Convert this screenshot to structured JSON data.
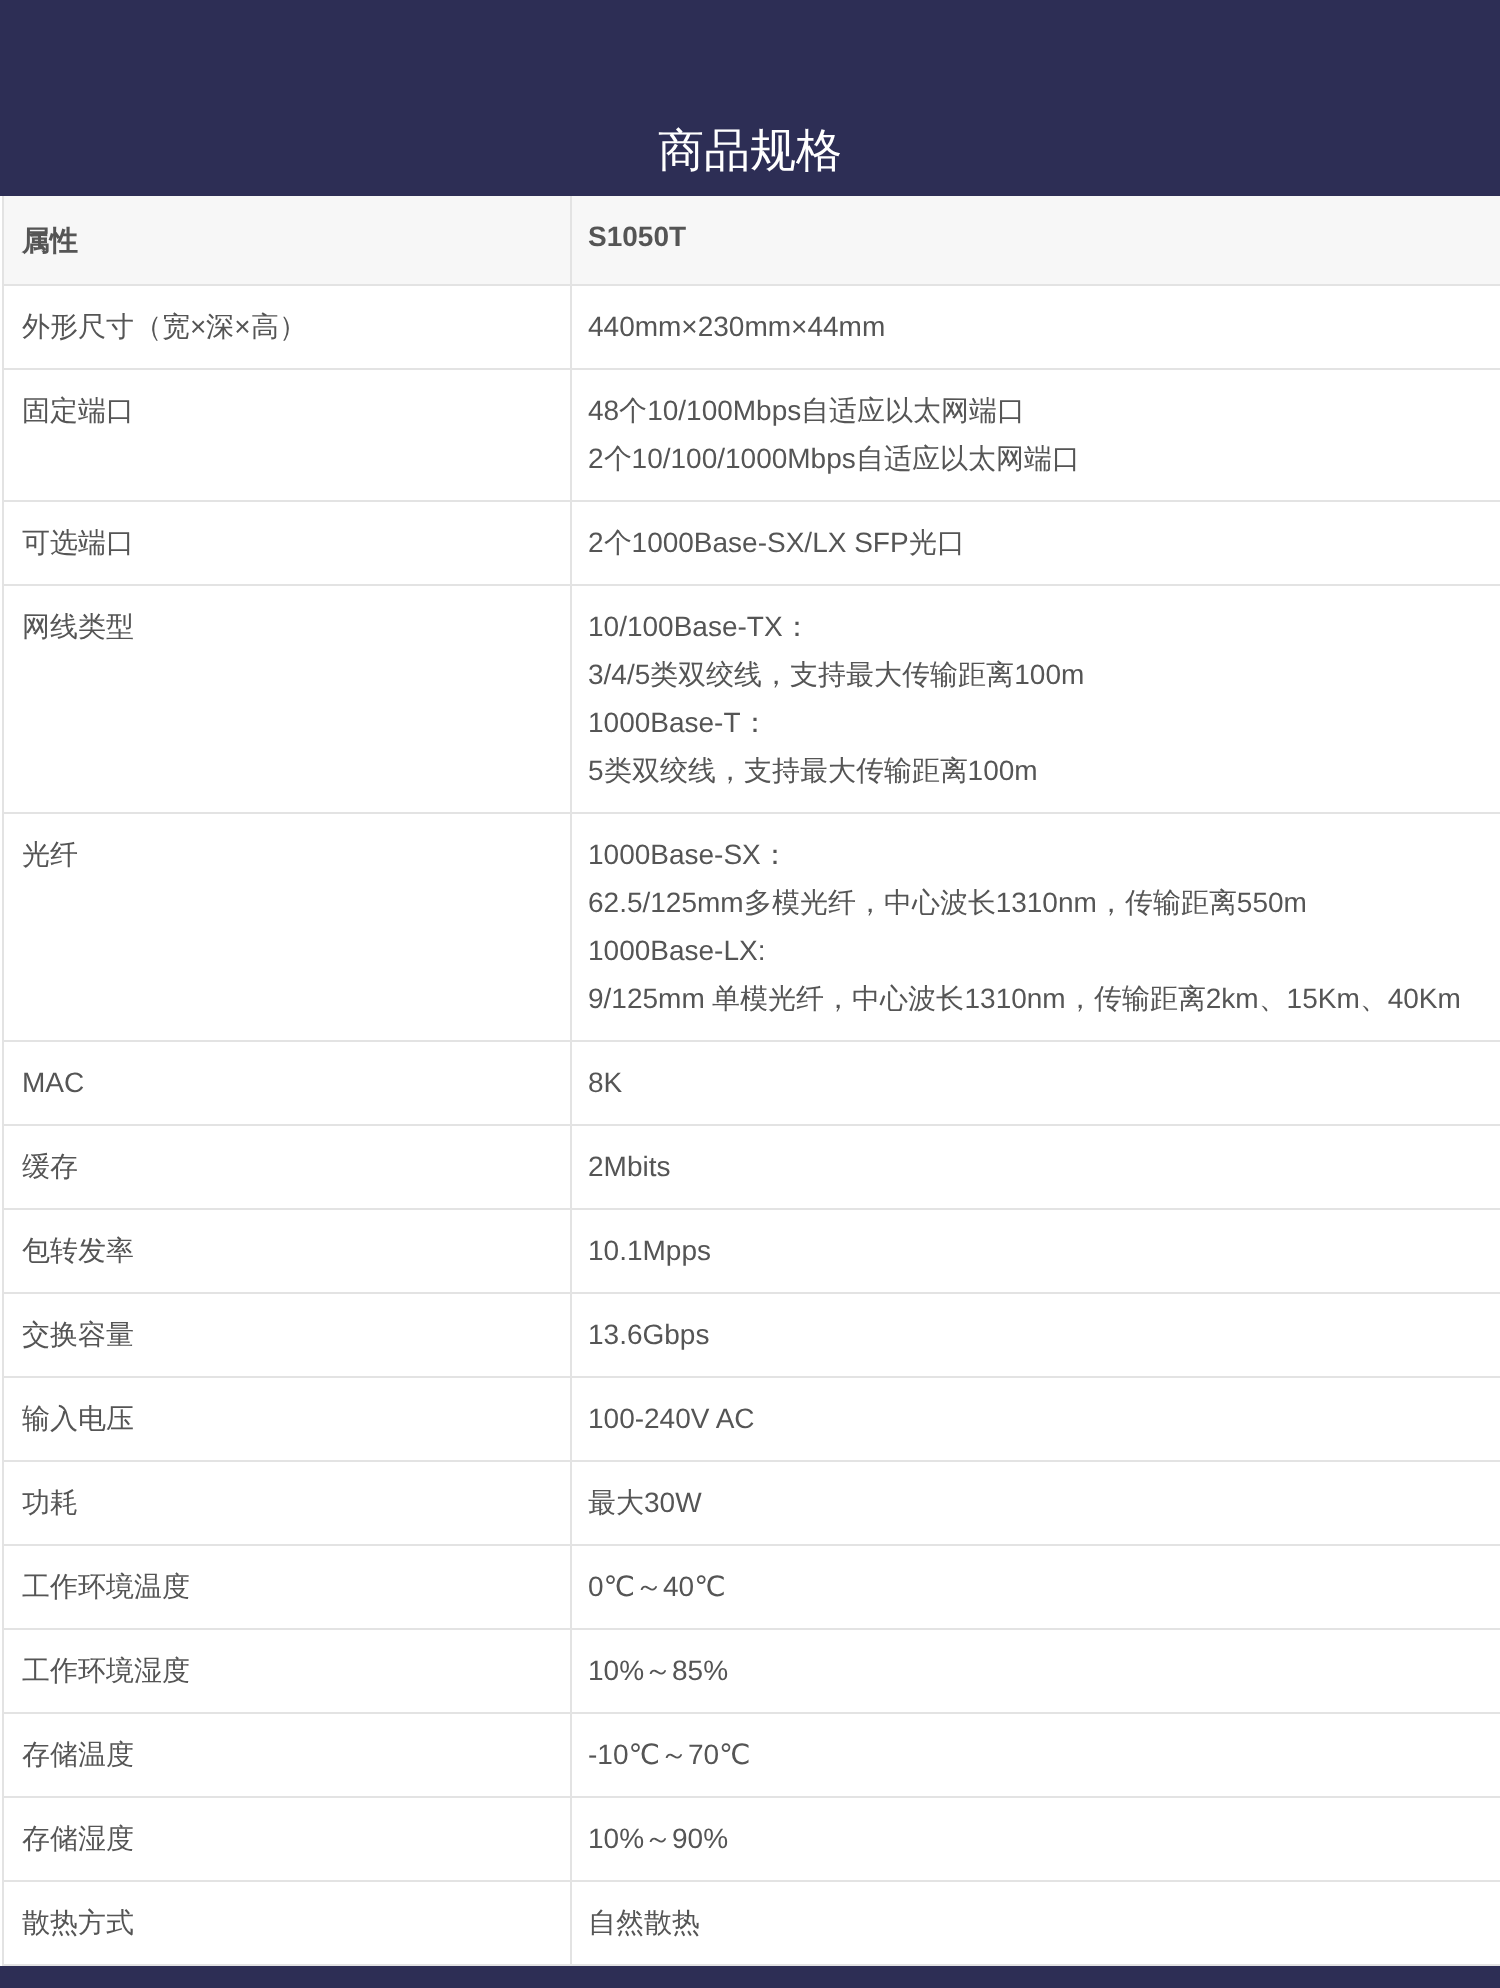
{
  "title": "商品规格",
  "table": {
    "columns": [
      "属性",
      "S1050T"
    ],
    "rows": [
      {
        "label": "外形尺寸（宽×深×高）",
        "value": [
          "440mm×230mm×44mm"
        ]
      },
      {
        "label": "固定端口",
        "value": [
          "48个10/100Mbps自适应以太网端口",
          "2个10/100/1000Mbps自适应以太网端口"
        ]
      },
      {
        "label": "可选端口",
        "value": [
          "2个1000Base-SX/LX SFP光口"
        ]
      },
      {
        "label": "网线类型",
        "value": [
          "10/100Base-TX：",
          "3/4/5类双绞线，支持最大传输距离100m",
          "1000Base-T：",
          "5类双绞线，支持最大传输距离100m"
        ]
      },
      {
        "label": "光纤",
        "value": [
          "1000Base-SX：",
          "62.5/125mm多模光纤，中心波长1310nm，传输距离550m",
          "1000Base-LX:",
          "9/125mm 单模光纤，中心波长1310nm，传输距离2km、15Km、40Km"
        ]
      },
      {
        "label": "MAC",
        "value": [
          "8K"
        ]
      },
      {
        "label": "缓存",
        "value": [
          "2Mbits"
        ]
      },
      {
        "label": "包转发率",
        "value": [
          "10.1Mpps"
        ]
      },
      {
        "label": "交换容量",
        "value": [
          "13.6Gbps"
        ]
      },
      {
        "label": "输入电压",
        "value": [
          "100-240V AC"
        ]
      },
      {
        "label": "功耗",
        "value": [
          "最大30W"
        ]
      },
      {
        "label": "工作环境温度",
        "value": [
          "0℃～40℃"
        ]
      },
      {
        "label": "工作环境湿度",
        "value": [
          "10%～85%"
        ]
      },
      {
        "label": "存储温度",
        "value": [
          "-10℃～70℃"
        ]
      },
      {
        "label": "存储湿度",
        "value": [
          "10%～90%"
        ]
      },
      {
        "label": "散热方式",
        "value": [
          "自然散热"
        ]
      }
    ]
  }
}
